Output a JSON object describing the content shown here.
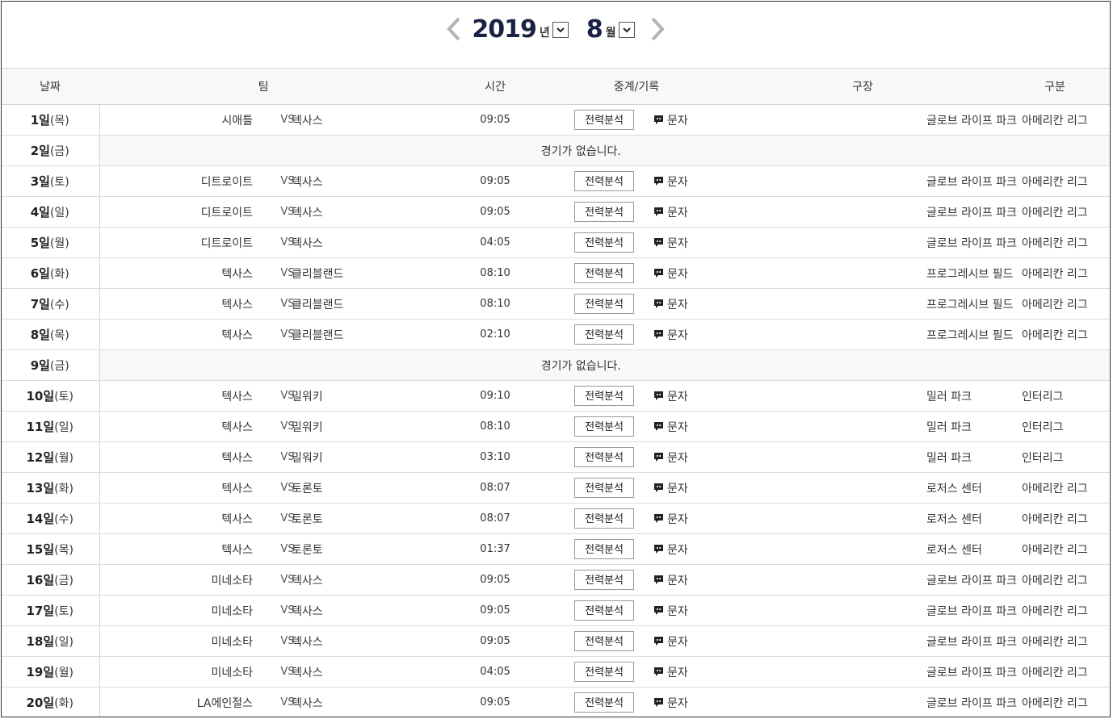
{
  "nav": {
    "year": "2019",
    "year_unit": "년",
    "month": "8",
    "month_unit": "월"
  },
  "headers": {
    "date": "날짜",
    "team": "팀",
    "time": "시간",
    "relay": "중계/기록",
    "stadium": "구장",
    "league": "구분"
  },
  "labels": {
    "vs": "VS",
    "analysis": "전력분석",
    "text": "문자"
  },
  "rows": [
    {
      "day": "1일",
      "dow": "(목)",
      "home": "시애틀",
      "away": "텍사스",
      "time": "09:05",
      "stadium": "글로브 라이프 파크",
      "league": "아메리칸 리그"
    },
    {
      "day": "2일",
      "dow": "(금)",
      "no_game": "경기가 없습니다."
    },
    {
      "day": "3일",
      "dow": "(토)",
      "home": "디트로이트",
      "away": "텍사스",
      "time": "09:05",
      "stadium": "글로브 라이프 파크",
      "league": "아메리칸 리그"
    },
    {
      "day": "4일",
      "dow": "(일)",
      "home": "디트로이트",
      "away": "텍사스",
      "time": "09:05",
      "stadium": "글로브 라이프 파크",
      "league": "아메리칸 리그"
    },
    {
      "day": "5일",
      "dow": "(월)",
      "home": "디트로이트",
      "away": "텍사스",
      "time": "04:05",
      "stadium": "글로브 라이프 파크",
      "league": "아메리칸 리그"
    },
    {
      "day": "6일",
      "dow": "(화)",
      "home": "텍사스",
      "away": "클리블랜드",
      "time": "08:10",
      "stadium": "프로그레시브 필드",
      "league": "아메리칸 리그"
    },
    {
      "day": "7일",
      "dow": "(수)",
      "home": "텍사스",
      "away": "클리블랜드",
      "time": "08:10",
      "stadium": "프로그레시브 필드",
      "league": "아메리칸 리그"
    },
    {
      "day": "8일",
      "dow": "(목)",
      "home": "텍사스",
      "away": "클리블랜드",
      "time": "02:10",
      "stadium": "프로그레시브 필드",
      "league": "아메리칸 리그"
    },
    {
      "day": "9일",
      "dow": "(금)",
      "no_game": "경기가 없습니다."
    },
    {
      "day": "10일",
      "dow": "(토)",
      "home": "텍사스",
      "away": "밀워키",
      "time": "09:10",
      "stadium": "밀러 파크",
      "league": "인터리그"
    },
    {
      "day": "11일",
      "dow": "(일)",
      "home": "텍사스",
      "away": "밀워키",
      "time": "08:10",
      "stadium": "밀러 파크",
      "league": "인터리그"
    },
    {
      "day": "12일",
      "dow": "(월)",
      "home": "텍사스",
      "away": "밀워키",
      "time": "03:10",
      "stadium": "밀러 파크",
      "league": "인터리그"
    },
    {
      "day": "13일",
      "dow": "(화)",
      "home": "텍사스",
      "away": "토론토",
      "time": "08:07",
      "stadium": "로저스 센터",
      "league": "아메리칸 리그"
    },
    {
      "day": "14일",
      "dow": "(수)",
      "home": "텍사스",
      "away": "토론토",
      "time": "08:07",
      "stadium": "로저스 센터",
      "league": "아메리칸 리그"
    },
    {
      "day": "15일",
      "dow": "(목)",
      "home": "텍사스",
      "away": "토론토",
      "time": "01:37",
      "stadium": "로저스 센터",
      "league": "아메리칸 리그"
    },
    {
      "day": "16일",
      "dow": "(금)",
      "home": "미네소타",
      "away": "텍사스",
      "time": "09:05",
      "stadium": "글로브 라이프 파크",
      "league": "아메리칸 리그"
    },
    {
      "day": "17일",
      "dow": "(토)",
      "home": "미네소타",
      "away": "텍사스",
      "time": "09:05",
      "stadium": "글로브 라이프 파크",
      "league": "아메리칸 리그"
    },
    {
      "day": "18일",
      "dow": "(일)",
      "home": "미네소타",
      "away": "텍사스",
      "time": "09:05",
      "stadium": "글로브 라이프 파크",
      "league": "아메리칸 리그"
    },
    {
      "day": "19일",
      "dow": "(월)",
      "home": "미네소타",
      "away": "텍사스",
      "time": "04:05",
      "stadium": "글로브 라이프 파크",
      "league": "아메리칸 리그"
    },
    {
      "day": "20일",
      "dow": "(화)",
      "home": "LA에인절스",
      "away": "텍사스",
      "time": "09:05",
      "stadium": "글로브 라이프 파크",
      "league": "아메리칸 리그"
    }
  ],
  "icons": {
    "prev": "chevron-left-icon",
    "next": "chevron-right-icon",
    "dropdown": "chevron-down-icon",
    "text": "speech-bubble-icon"
  },
  "colors": {
    "title": "#1b2345",
    "header_bg": "#f8f8fa",
    "icon_gray": "#bbbbbb"
  }
}
